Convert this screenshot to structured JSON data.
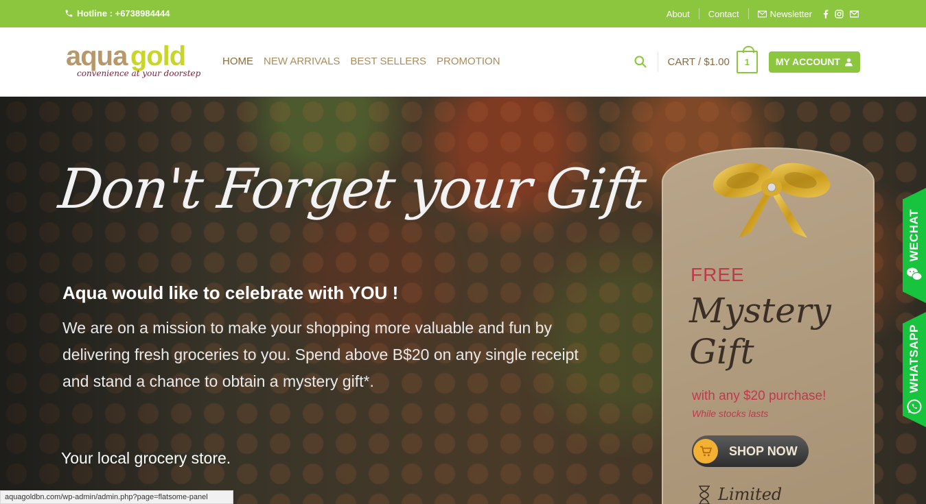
{
  "topbar": {
    "hotline": "Hotline : +6738984444",
    "links": {
      "about": "About",
      "contact": "Contact",
      "newsletter": "Newsletter"
    }
  },
  "header": {
    "logo": {
      "aqua": "aqua",
      "gold": "gold",
      "tagline": "convenience at your doorstep"
    },
    "nav": [
      "HOME",
      "NEW ARRIVALS",
      "BEST SELLERS",
      "PROMOTION"
    ],
    "cart_label": "CART / $1.00",
    "cart_count": "1",
    "account_label": "MY ACCOUNT"
  },
  "hero": {
    "headline": "Don't Forget your Gift !",
    "subheading": "Aqua would like to celebrate with YOU !",
    "body": "We are on a mission to make your shopping more valuable and fun by delivering fresh groceries to you. Spend above B$20 on any single receipt and stand a chance to obtain a mystery gift*.",
    "local": "Your local grocery store."
  },
  "gift_tag": {
    "free": "FREE",
    "mystery": "Mystery",
    "gift": "Gift",
    "with_purchase": "with any $20 purchase!",
    "stocks": "While stocks lasts",
    "shop_now": "SHOP NOW",
    "limited": "Limited"
  },
  "side_tabs": {
    "wechat": "WECHAT",
    "whatsapp": "WHATSAPP"
  },
  "status_url": "aquagoldbn.com/wp-admin/admin.php?page=flatsome-panel",
  "colors": {
    "accent_green": "#8cc63f",
    "brand_brown": "#a98b5e",
    "promo_red": "#c0394a",
    "social_green": "#18c33e"
  }
}
